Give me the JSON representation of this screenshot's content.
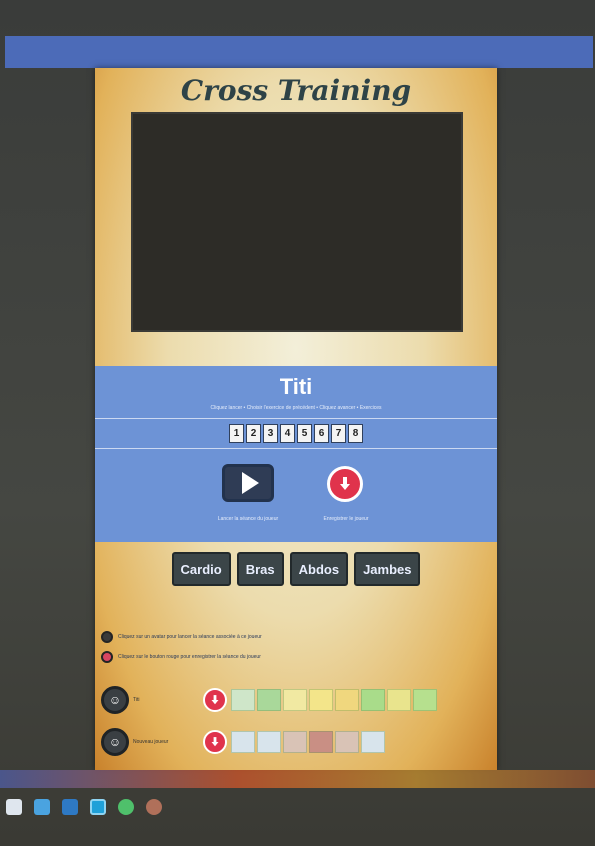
{
  "app": {
    "title": "Cross Training",
    "player_name": "Titi",
    "panel_hint": "Cliquez lancer • Choisir l'exercice de précédent • Cliquez avancer • Exercices",
    "steps": [
      "1",
      "2",
      "3",
      "4",
      "5",
      "6",
      "7",
      "8"
    ],
    "play_caption": "Lancer la séance du joueur",
    "download_caption": "Enregistrer le joueur",
    "categories": [
      "Cardio",
      "Bras",
      "Abdos",
      "Jambes"
    ],
    "legend": [
      {
        "text": "Cliquez sur un avatar pour lancer la séance associée à ce joueur",
        "color": "dark"
      },
      {
        "text": "Cliquez sur le bouton rouge pour enregistrer la séance du joueur",
        "color": "red"
      }
    ],
    "rows": [
      {
        "name": "Titi",
        "cells": [
          "",
          "",
          "",
          "",
          "",
          "",
          "",
          "",
          "",
          ""
        ]
      },
      {
        "name": "Nouveau joueur",
        "cells": [
          "",
          "",
          "",
          "",
          "",
          "",
          ""
        ]
      }
    ]
  },
  "colors": {
    "panel": "#6d93d6",
    "accent_red": "#e0334c",
    "title": "#2e4347",
    "top_bar": "#4c6bb8"
  },
  "icons": {
    "play": "play-icon",
    "download": "download-icon",
    "avatar": "avatar-icon"
  },
  "dock": [
    "files-icon",
    "folder-icon",
    "browser-icon",
    "editor-icon",
    "chat-icon",
    "media-icon"
  ]
}
